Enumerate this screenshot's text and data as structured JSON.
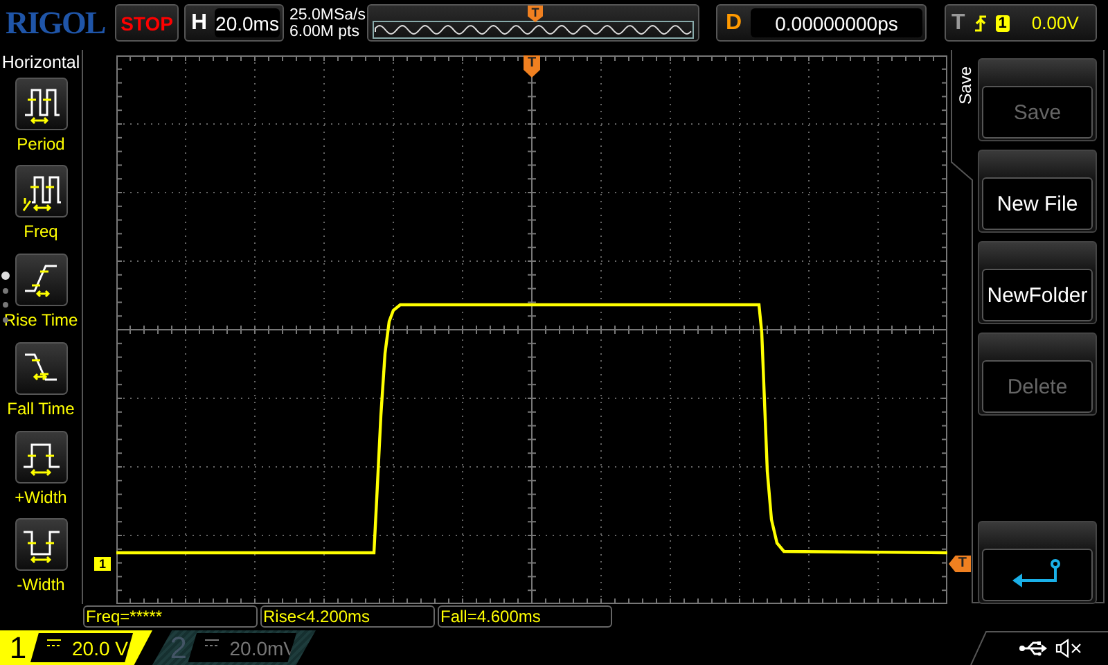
{
  "brand": "RIGOL",
  "run_state": {
    "text": "STOP",
    "running": false
  },
  "horizontal": {
    "label": "H",
    "timebase": "20.0ms"
  },
  "acquisition": {
    "sample_rate": "25.0MSa/s",
    "memory_depth": "6.00M pts"
  },
  "overview": {
    "trigger_marker": "T"
  },
  "delay": {
    "label": "D",
    "value": "0.00000000ps"
  },
  "trigger": {
    "label": "T",
    "source": "1",
    "level": "0.00V"
  },
  "side_menu": {
    "title": "Horizontal",
    "pages": [
      {
        "selected": true
      },
      {
        "selected": false
      },
      {
        "selected": false
      },
      {
        "selected": false
      }
    ],
    "items": [
      {
        "label": "Period",
        "kind": "period"
      },
      {
        "label": "Freq",
        "kind": "freq"
      },
      {
        "label": "Rise Time",
        "kind": "rise"
      },
      {
        "label": "Fall Time",
        "kind": "fall"
      },
      {
        "label": "+Width",
        "kind": "pwidth"
      },
      {
        "label": "-Width",
        "kind": "nwidth"
      }
    ]
  },
  "graticule": {
    "trigger_position_marker": "T",
    "channel_1_marker": "1",
    "trigger_level_marker": "T"
  },
  "soft_menu": {
    "title": "Save",
    "buttons": [
      {
        "kind": "text",
        "label": "Save",
        "disabled": true
      },
      {
        "kind": "text",
        "label": "New File",
        "disabled": false
      },
      {
        "kind": "text",
        "label": "NewFolder",
        "disabled": false
      },
      {
        "kind": "text",
        "label": "Delete",
        "disabled": true
      },
      {
        "kind": "back"
      }
    ]
  },
  "measurements": [
    "Freq=*****",
    "Rise<4.200ms",
    "Fall=4.600ms"
  ],
  "channels": [
    {
      "number": "1",
      "scale": "20.0 V",
      "on": true
    },
    {
      "number": "2",
      "scale": "20.0mV",
      "on": false
    }
  ],
  "status": {
    "usb": true,
    "muted": true
  }
}
